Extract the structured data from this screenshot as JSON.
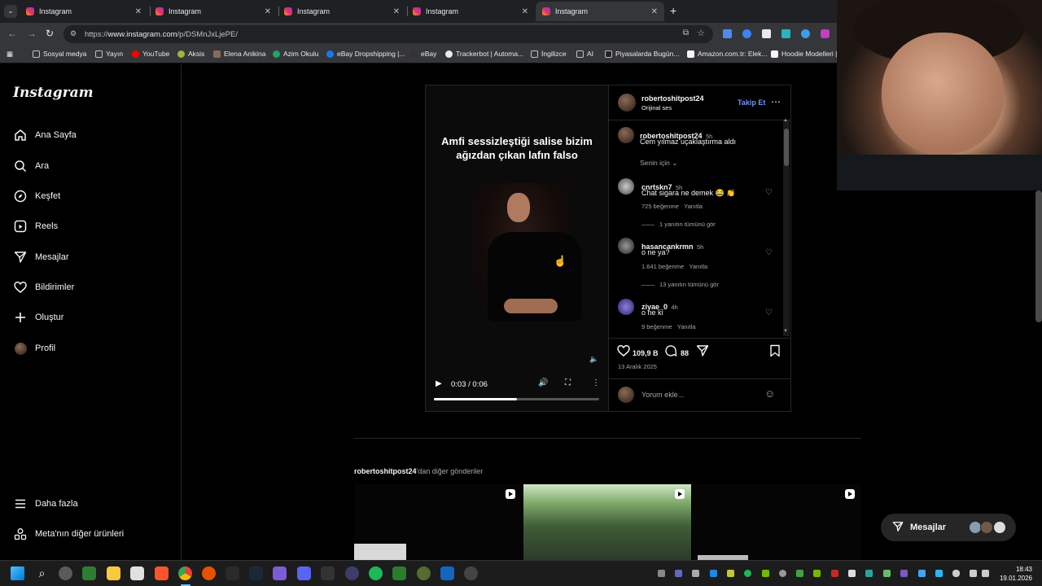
{
  "browser": {
    "tabs": [
      {
        "label": "Instagram",
        "active": false
      },
      {
        "label": "Instagram",
        "active": false
      },
      {
        "label": "Instagram",
        "active": false
      },
      {
        "label": "Instagram",
        "active": false
      },
      {
        "label": "Instagram",
        "active": true
      }
    ],
    "new_tab": "+",
    "url_prefix": "https://",
    "url_host": "www.instagram.com",
    "url_path": "/p/DSMnJxLjePE/",
    "bookmarks": [
      "Sosyal medya",
      "Yayın",
      "YouTube",
      "Aksis",
      "Elena Anikina",
      "Azim Okulu",
      "eBay Dropshipping |...",
      "eBay",
      "Trackerbot | Automa...",
      "İngilizce",
      "AI",
      "Piyasalarda Bugün...",
      "Amazon.com.tr: Elek...",
      "Hoodie Modelleri |"
    ]
  },
  "sidebar": {
    "logo": "Instagram",
    "items": [
      "Ana Sayfa",
      "Ara",
      "Keşfet",
      "Reels",
      "Mesajlar",
      "Bildirimler",
      "Oluştur",
      "Profil"
    ],
    "more": "Daha fazla",
    "meta": "Meta'nın diğer ürünleri"
  },
  "post": {
    "video_caption": "Amfi sessizleştiği salise bizim ağızdan çıkan lafın falso",
    "video_time": "0:03 / 0:06",
    "video_progress": 0.5,
    "author": "robertoshitpost24",
    "audio": "Orijinal ses",
    "follow": "Takip Et",
    "caption_user": "robertoshitpost24",
    "caption_time": "5h",
    "caption_text": "Cem yılmaz uçaklaştırma aldı",
    "for_you": "Senin için",
    "comments": [
      {
        "user": "cnrtskn7",
        "time": "5h",
        "text": "Chat sigara ne demek 😂 👏",
        "likes": "725 beğenme",
        "reply": "Yanıtla",
        "view_replies": "1 yanıtın tümünü gör"
      },
      {
        "user": "hasancankrmn",
        "time": "5h",
        "text": "o ne ya?",
        "likes": "1.641 beğenme",
        "reply": "Yanıtla",
        "view_replies": "13 yanıtın tümünü gör"
      },
      {
        "user": "ziyae_0",
        "time": "4h",
        "text": "o ne ki",
        "likes": "9 beğenme",
        "reply": "Yanıtla",
        "view_replies": ""
      }
    ],
    "like_count": "109,9 B",
    "comment_count": "88",
    "date": "13 Aralık 2025",
    "comment_placeholder": "Yorum ekle..."
  },
  "more_posts": {
    "user": "robertoshitpost24",
    "suffix": "'dan diğer gönderiler"
  },
  "messages_pill": "Mesajlar",
  "clock": {
    "time": "18:43",
    "date": "19.01.2026"
  },
  "colors": {
    "accent": "#0095f6",
    "follow": "#5d8df6",
    "bg": "#000000"
  }
}
